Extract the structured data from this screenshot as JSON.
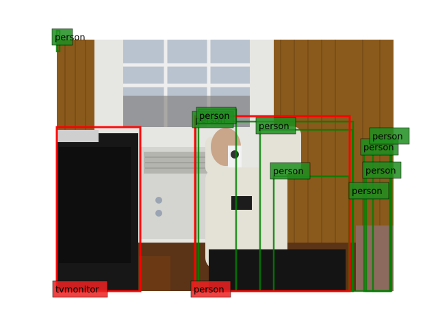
{
  "image": {
    "description_colors": {
      "wall": "#8a5a1c",
      "window_frame": "#e6e6e2",
      "floor": "#5b3417",
      "tv_body": "#171717",
      "shirt": "#e4e1d6",
      "pants": "#141414"
    }
  },
  "detections": {
    "colors": {
      "red": "#ff0000",
      "green": "#008000",
      "red_label_bg": "#ee2222",
      "green_label_bg": "#1f8f1f"
    },
    "labels": [
      {
        "id": "det-0",
        "text": "person",
        "color": "green"
      },
      {
        "id": "det-1",
        "text": "person",
        "color": "green"
      },
      {
        "id": "det-2",
        "text": "person",
        "color": "green"
      },
      {
        "id": "det-3",
        "text": "person",
        "color": "green"
      },
      {
        "id": "det-4",
        "text": "person",
        "color": "green"
      },
      {
        "id": "det-5",
        "text": "person",
        "color": "green"
      },
      {
        "id": "det-6",
        "text": "person",
        "color": "green"
      },
      {
        "id": "det-7",
        "text": "person",
        "color": "green"
      },
      {
        "id": "det-8",
        "text": "person",
        "color": "green"
      },
      {
        "id": "det-9",
        "text": "tvmonitor",
        "color": "red"
      },
      {
        "id": "det-10",
        "text": "person",
        "color": "red"
      }
    ]
  }
}
